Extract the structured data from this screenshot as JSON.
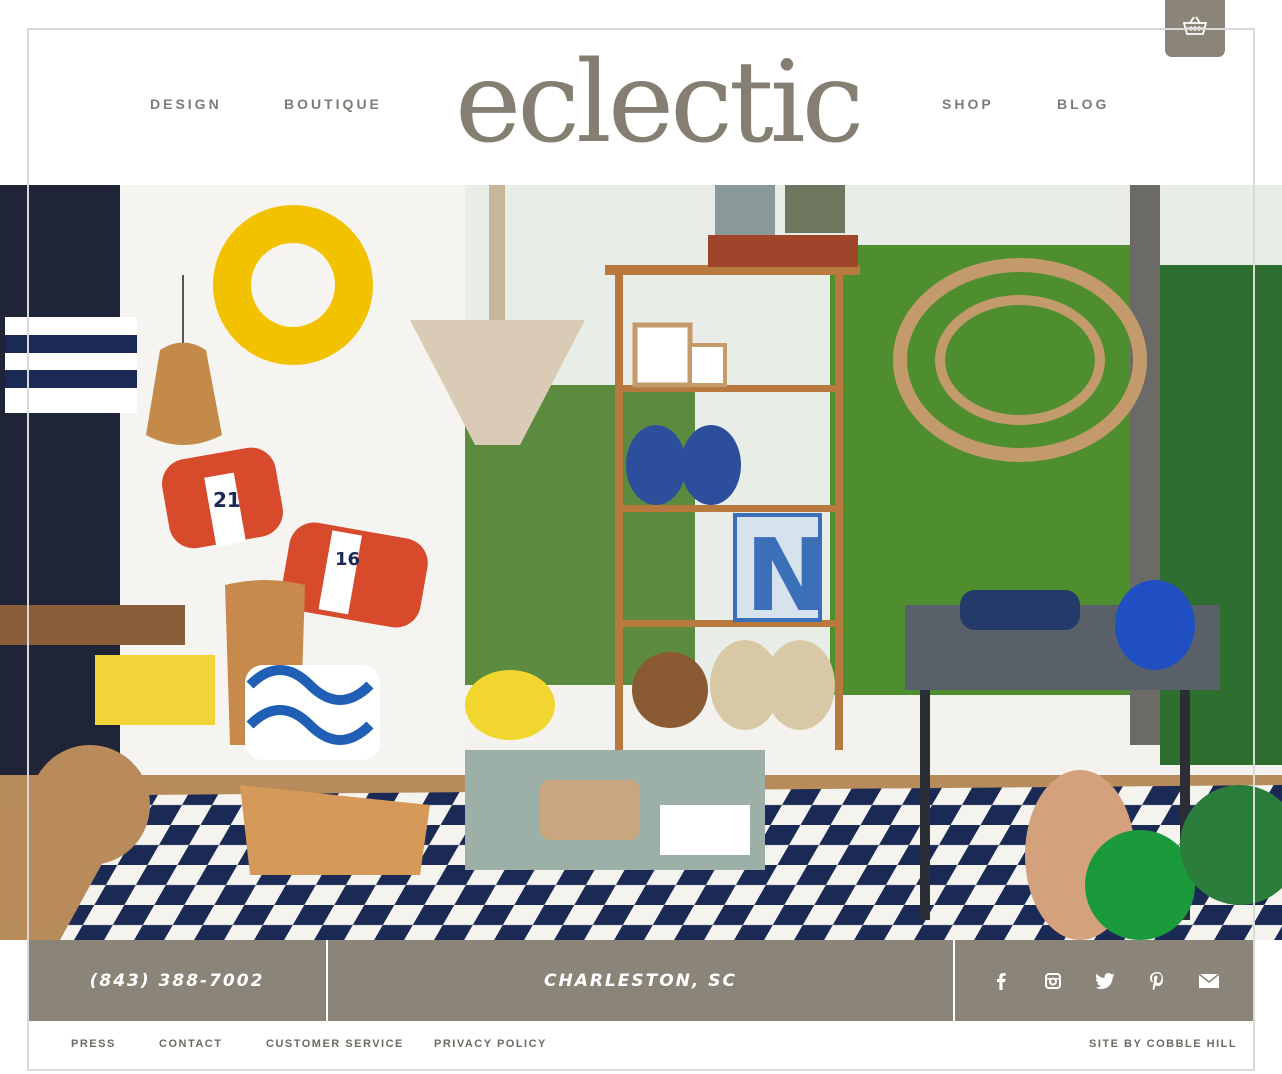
{
  "header": {
    "logo_text": "eclectic",
    "nav_left": [
      "DESIGN",
      "BOUTIQUE"
    ],
    "nav_right": [
      "SHOP",
      "BLOG"
    ],
    "cart_icon": "basket-icon"
  },
  "hero": {
    "alt": "Eclectic boutique interior"
  },
  "contact_bar": {
    "phone": "(843) 388-7002",
    "location": "CHARLESTON, SC",
    "social_icons": [
      "facebook-icon",
      "instagram-icon",
      "twitter-icon",
      "pinterest-icon",
      "email-icon"
    ]
  },
  "footer": {
    "links": [
      "PRESS",
      "CONTACT",
      "CUSTOMER SERVICE",
      "PRIVACY POLICY"
    ],
    "credit": "SITE BY COBBLE HILL"
  },
  "colors": {
    "brand_taupe": "#8b8478",
    "logo": "#857f73",
    "rug_navy": "#1b2a55",
    "buoy_red": "#d84a2c",
    "ring_yellow": "#f2c200"
  }
}
